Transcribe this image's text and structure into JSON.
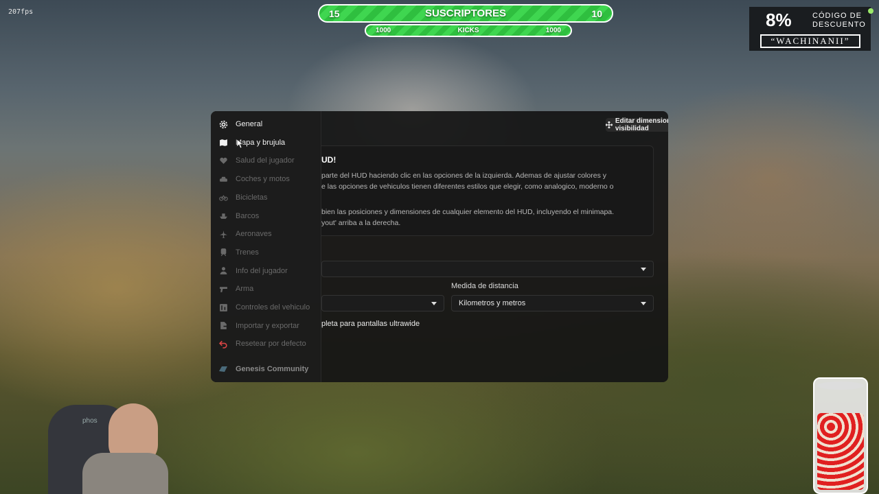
{
  "overlay": {
    "fps": "207fps",
    "subscribers": {
      "left": "15",
      "label": "SUSCRIPTORES",
      "right": "10"
    },
    "kicks": {
      "left": "1000",
      "label": "KICKS",
      "right": "1000"
    },
    "promo": {
      "percent": "8%",
      "text": "CÓDIGO DE DESCUENTO",
      "code": "“WACHINANII”"
    },
    "chair_brand": "phos"
  },
  "modal": {
    "edit_button": "Editar dimensiones, posiciones y visibilidad",
    "sidebar": [
      {
        "label": "General",
        "icon": "gear-icon",
        "state": "active"
      },
      {
        "label": "Mapa y brujula",
        "icon": "map-icon",
        "state": "hover"
      },
      {
        "label": "Salud del jugador",
        "icon": "heart-icon",
        "state": ""
      },
      {
        "label": "Coches y motos",
        "icon": "car-icon",
        "state": ""
      },
      {
        "label": "Bicicletas",
        "icon": "bicycle-icon",
        "state": ""
      },
      {
        "label": "Barcos",
        "icon": "boat-icon",
        "state": ""
      },
      {
        "label": "Aeronaves",
        "icon": "plane-icon",
        "state": ""
      },
      {
        "label": "Trenes",
        "icon": "train-icon",
        "state": ""
      },
      {
        "label": "Info del jugador",
        "icon": "user-icon",
        "state": ""
      },
      {
        "label": "Arma",
        "icon": "gun-icon",
        "state": ""
      },
      {
        "label": "Controles del vehiculo",
        "icon": "controls-icon",
        "state": ""
      },
      {
        "label": "Importar y exportar",
        "icon": "file-export-icon",
        "state": ""
      },
      {
        "label": "Resetear por defecto",
        "icon": "undo-icon",
        "state": "reset"
      }
    ],
    "community": "Genesis Community",
    "info": {
      "title": "UD!",
      "lines": [
        "parte del HUD haciendo clic en las opciones de la izquierda. Ademas de ajustar colores y",
        "e las opciones de vehiculos tienen diferentes estilos que elegir, como analogico, moderno o",
        "bien las posiciones y dimensiones de cualquier elemento del HUD, incluyendo el minimapa.",
        "yout' arriba a la derecha."
      ]
    },
    "distance_label": "Medida de distancia",
    "distance_value": "Kilometros y metros",
    "ultrawide_text": "pleta para pantallas ultrawide"
  }
}
